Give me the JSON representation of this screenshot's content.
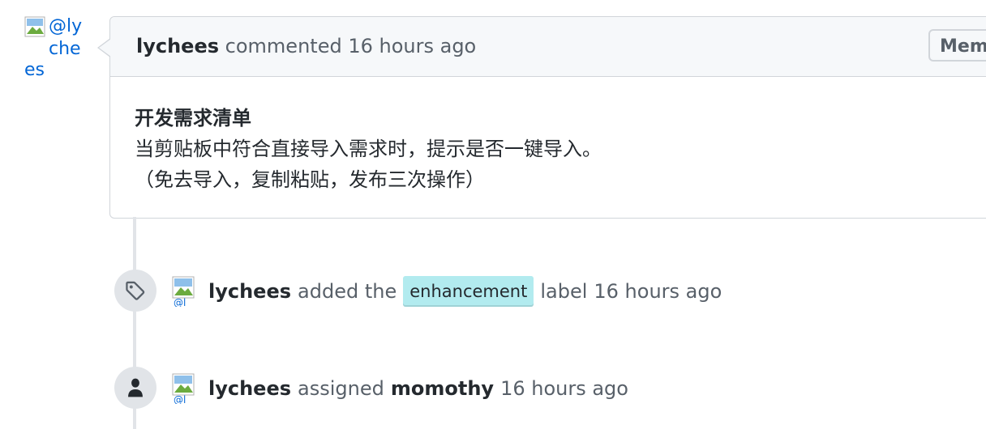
{
  "avatar": {
    "alt_text_line1": "@ly",
    "alt_text_line2": "che",
    "alt_text_line3": "es"
  },
  "comment": {
    "author": "lychees",
    "action": "commented",
    "time": "16 hours ago",
    "role_badge": "Member",
    "body_title": "开发需求清单",
    "body_line1": "当剪贴板中符合直接导入需求时，提示是否一键导入。",
    "body_line2": "（免去导入，复制粘贴，发布三次操作）"
  },
  "events": [
    {
      "icon": "tag-icon",
      "actor": "lychees",
      "text_before": "added the",
      "label": "enhancement",
      "label_color": "#b2ebef",
      "text_after": "label",
      "time": "16 hours ago"
    },
    {
      "icon": "person-icon",
      "actor": "lychees",
      "text_before": "assigned",
      "assignee": "momothy",
      "time": "16 hours ago"
    }
  ]
}
